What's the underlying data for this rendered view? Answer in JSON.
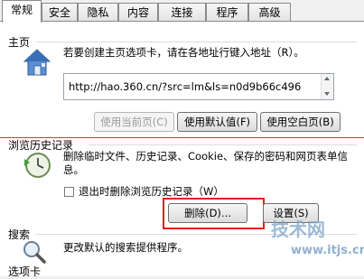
{
  "tabs": [
    {
      "label": "常规",
      "active": true
    },
    {
      "label": "安全",
      "active": false
    },
    {
      "label": "隐私",
      "active": false
    },
    {
      "label": "内容",
      "active": false
    },
    {
      "label": "连接",
      "active": false
    },
    {
      "label": "程序",
      "active": false
    },
    {
      "label": "高级",
      "active": false
    }
  ],
  "homepage": {
    "title": "主页",
    "description": "若要创建主页选项卡，请在各地址行键入地址（R）。",
    "url": "http://hao.360.cn/?src=lm&ls=n0d9b66c496",
    "use_current": "使用当前页(C)",
    "use_default": "使用默认值(F)",
    "use_blank": "使用空白页(B)"
  },
  "history": {
    "title": "浏览历史记录",
    "description": "删除临时文件、历史记录、Cookie、保存的密码和网页表单信息。",
    "checkbox_label": "退出时删除浏览历史记录（W）",
    "delete_button": "删除(D)...",
    "settings_button": "设置(S)"
  },
  "search": {
    "title": "搜索",
    "description": "更改默认的搜索提供程序。"
  },
  "tabs_section": {
    "title": "选项卡"
  },
  "watermark": {
    "brand": "技术网",
    "domain": "www.itjs.cn"
  },
  "colors": {
    "highlight": "#e02020",
    "divider_red": "#d23a3a"
  }
}
